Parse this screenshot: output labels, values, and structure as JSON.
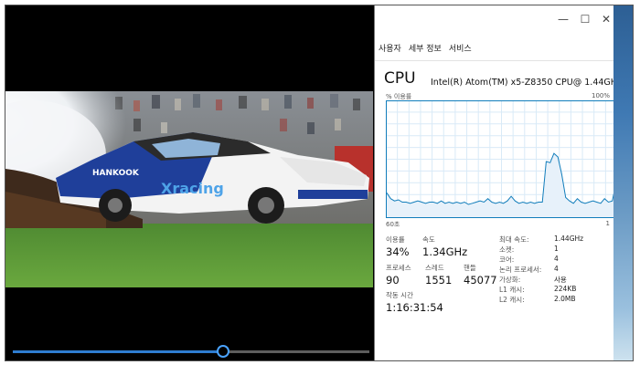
{
  "task_manager": {
    "window_controls": {
      "minimize": "—",
      "maximize": "☐",
      "close": "✕"
    },
    "tabs": [
      {
        "label": "사용자",
        "active": false
      },
      {
        "label": "세부 정보",
        "active": false
      },
      {
        "label": "서비스",
        "active": false
      }
    ],
    "cpu_title": "CPU",
    "cpu_model": "Intel(R) Atom(TM) x5-Z8350 CPU@ 1.44GHz",
    "graph": {
      "usage_label": "% 이용률",
      "max_label": "100%",
      "time_label": "60초",
      "min_label": "1",
      "line_color": "#117dbb",
      "fill_color": "#e7f1fa",
      "usage_series": [
        21,
        16,
        14,
        15,
        13,
        13,
        12,
        13,
        14,
        13,
        12,
        13,
        13,
        12,
        14,
        12,
        13,
        12,
        13,
        12,
        13,
        11,
        12,
        13,
        14,
        13,
        16,
        13,
        12,
        13,
        12,
        14,
        18,
        14,
        12,
        13,
        12,
        13,
        12,
        13,
        13,
        48,
        47,
        55,
        52,
        37,
        17,
        14,
        12,
        16,
        13,
        12,
        13,
        14,
        13,
        12,
        16,
        13,
        14,
        30
      ]
    },
    "stats": {
      "usage": {
        "label": "이용률",
        "value": "34%"
      },
      "speed": {
        "label": "속도",
        "value": "1.34GHz"
      },
      "processes": {
        "label": "프로세스",
        "value": "90"
      },
      "threads": {
        "label": "스레드",
        "value": "1551"
      },
      "handles": {
        "label": "핸들",
        "value": "45077"
      },
      "uptime": {
        "label": "작동 시간",
        "value": "1:16:31:54"
      }
    },
    "details": [
      {
        "key": "최대 속도:",
        "value": "1.44GHz"
      },
      {
        "key": "소켓:",
        "value": "1"
      },
      {
        "key": "코어:",
        "value": "4"
      },
      {
        "key": "논리 프로세서:",
        "value": "4"
      },
      {
        "key": "가상화:",
        "value": "사용"
      },
      {
        "key": "L1 캐시:",
        "value": "224KB"
      },
      {
        "key": "L2 캐시:",
        "value": "2.0MB"
      }
    ]
  },
  "player": {
    "progress": 0.59,
    "video_logo": "HANKOOK",
    "video_logo_2": "Xracing"
  }
}
